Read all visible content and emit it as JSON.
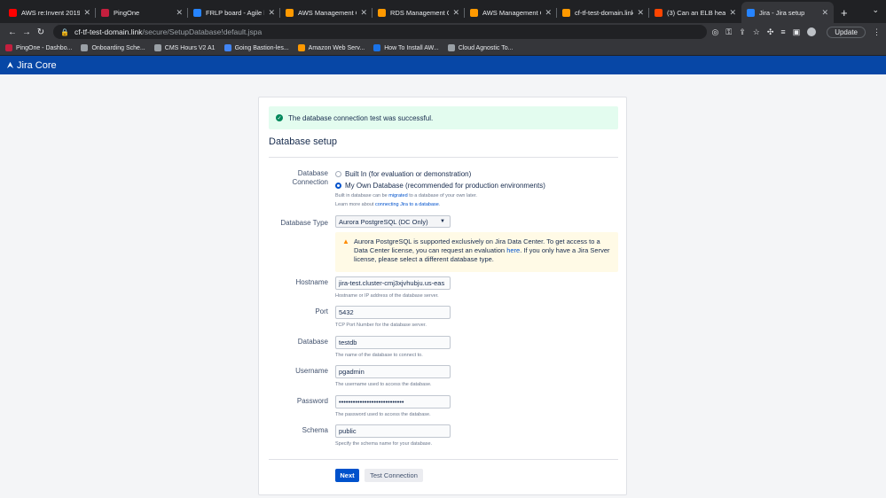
{
  "browser": {
    "tabs": [
      {
        "title": "AWS re:Invent 2019 - K",
        "favicon_color": "#ff0000",
        "active": false
      },
      {
        "title": "PingOne",
        "favicon_color": "#c41f3e",
        "active": false
      },
      {
        "title": "FRLP board - Agile boa",
        "favicon_color": "#2684ff",
        "active": false
      },
      {
        "title": "AWS Management Con",
        "favicon_color": "#ff9900",
        "active": false
      },
      {
        "title": "RDS Management Con",
        "favicon_color": "#ff9900",
        "active": false
      },
      {
        "title": "AWS Management Con",
        "favicon_color": "#ff9900",
        "active": false
      },
      {
        "title": "cf-tf-test-domain.link",
        "favicon_color": "#ff9900",
        "active": false
      },
      {
        "title": "(3) Can an ELB health c",
        "favicon_color": "#ff4500",
        "active": false
      },
      {
        "title": "Jira - Jira setup",
        "favicon_color": "#2684ff",
        "active": true
      }
    ],
    "close_glyph": "✕",
    "new_tab": "+",
    "url_host": "cf-tf-test-domain.link",
    "url_path": "/secure/SetupDatabase!default.jspa",
    "update_label": "Update",
    "bookmarks": [
      {
        "label": "PingOne - Dashbo...",
        "color": "#c41f3e"
      },
      {
        "label": "Onboarding Sche...",
        "color": "#9aa0a6"
      },
      {
        "label": "CMS Hours V2 A1",
        "color": "#9aa0a6"
      },
      {
        "label": "Going Bastion-les...",
        "color": "#4285f4"
      },
      {
        "label": "Amazon Web Serv...",
        "color": "#ff9900"
      },
      {
        "label": "How To Install AW...",
        "color": "#1a73e8"
      },
      {
        "label": "Cloud Agnostic To...",
        "color": "#9aa0a6"
      }
    ]
  },
  "app": {
    "logo_text": "Jira Core"
  },
  "setup": {
    "success_message": "The database connection test was successful.",
    "title": "Database setup",
    "db_connection_label": "Database Connection",
    "radio_builtin": "Built In (for evaluation or demonstration)",
    "radio_own": "My Own Database (recommended for production environments)",
    "connection_desc_1": "Built in database can be",
    "connection_desc_link1": "migrated",
    "connection_desc_2": "to a database of your own later.",
    "connection_desc_3": "Learn more about",
    "connection_desc_link2": "connecting Jira to a database",
    "db_type_label": "Database Type",
    "db_type_value": "Aurora PostgreSQL (DC Only)",
    "warning_1": "Aurora PostgreSQL is supported exclusively on Jira Data Center. To get access to a Data Center license, you can request an evaluation",
    "warning_link": "here",
    "warning_2": ". If you only have a Jira Server license, please select a different database type.",
    "fields": {
      "hostname": {
        "label": "Hostname",
        "value": "jira-test.cluster-cmj3xjvhubju.us-eas",
        "help": "Hostname or IP address of the database server."
      },
      "port": {
        "label": "Port",
        "value": "5432",
        "help": "TCP Port Number for the database server."
      },
      "database": {
        "label": "Database",
        "value": "testdb",
        "help": "The name of the database to connect to."
      },
      "username": {
        "label": "Username",
        "value": "pgadmin",
        "help": "The username used to access the database."
      },
      "password": {
        "label": "Password",
        "value": "••••••••••••••••••••••••••••",
        "help": "The password used to access the database."
      },
      "schema": {
        "label": "Schema",
        "value": "public",
        "help": "Specify the schema name for your database."
      }
    },
    "next_label": "Next",
    "test_label": "Test Connection"
  }
}
